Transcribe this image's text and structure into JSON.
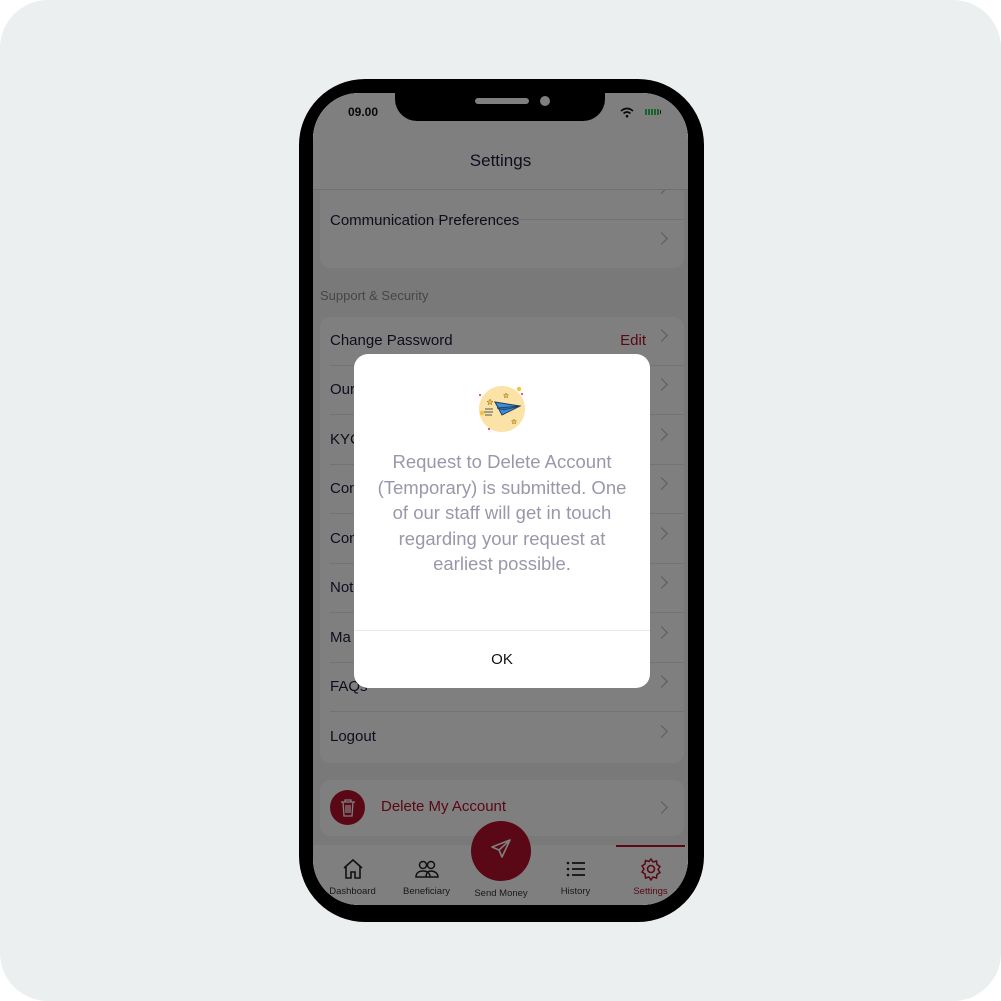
{
  "status_bar": {
    "time": "09.00",
    "wifi_icon": "wifi-icon",
    "battery_icon": "battery-icon",
    "battery_color": "#35c759"
  },
  "header": {
    "title": "Settings"
  },
  "sections": [
    {
      "items": [
        {
          "label": "Communication Preferences"
        }
      ]
    },
    {
      "title": "Support & Security",
      "items": [
        {
          "label": "Change Password",
          "action": "Edit"
        },
        {
          "label": "Our"
        },
        {
          "label": "KYC"
        },
        {
          "label": "Con"
        },
        {
          "label": "Con"
        },
        {
          "label": "Not"
        },
        {
          "label": "Ma"
        },
        {
          "label": "FAQs"
        },
        {
          "label": "Logout"
        }
      ]
    }
  ],
  "delete_account": {
    "label": "Delete My Account",
    "icon": "trash-icon"
  },
  "tabbar": {
    "tabs": [
      {
        "label": "Dashboard",
        "icon": "home-icon"
      },
      {
        "label": "Beneficiary",
        "icon": "users-icon"
      },
      {
        "label": "Send Money",
        "icon": "send-icon"
      },
      {
        "label": "History",
        "icon": "list-icon"
      },
      {
        "label": "Settings",
        "icon": "gear-icon",
        "active": true
      }
    ]
  },
  "modal": {
    "illustration": "paper-plane-icon",
    "message": "Request to Delete Account (Temporary) is submitted. One of our staff will get in touch regarding your request at earliest possible.",
    "ok_label": "OK"
  },
  "colors": {
    "brand": "#b5102a",
    "background": "#eceff0",
    "text": "#1d1b3a",
    "modal_text": "#9a97aa"
  }
}
